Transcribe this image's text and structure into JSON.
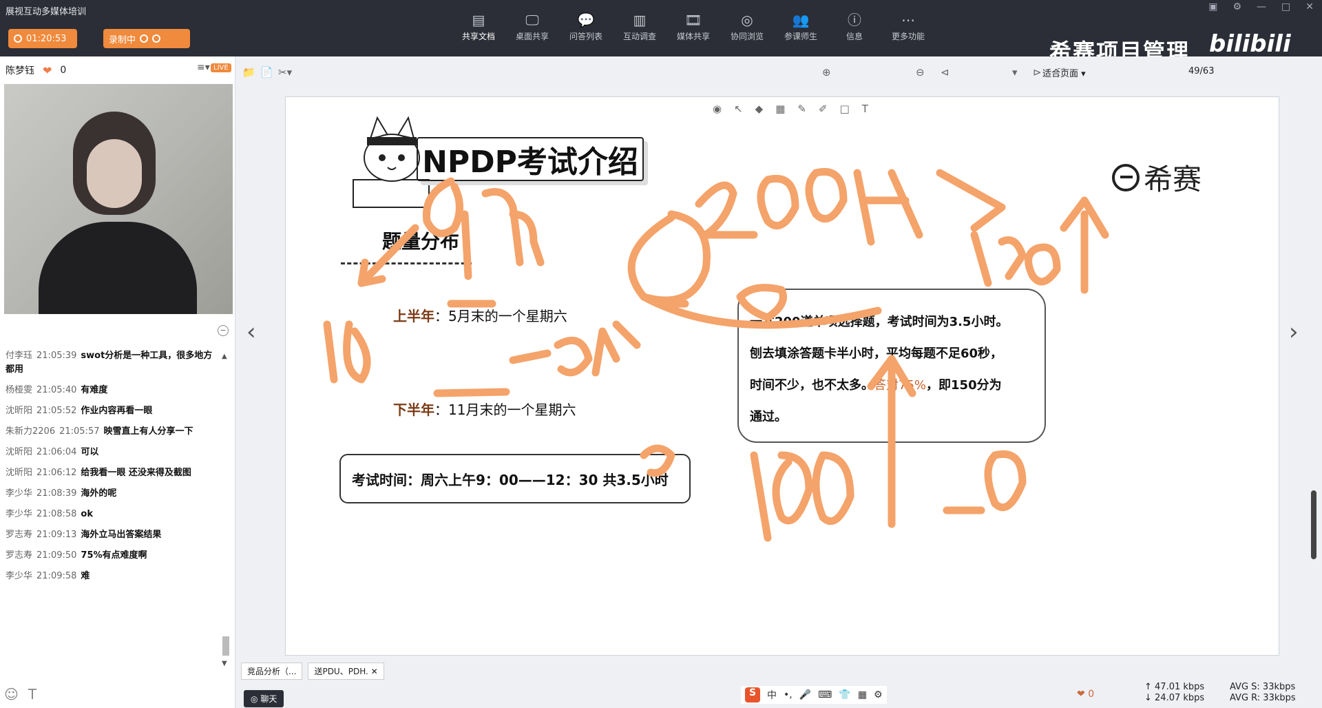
{
  "app": {
    "title": "展视互动多媒体培训",
    "timer": "01:20:53",
    "recording_label": "录制中",
    "brand": "希赛项目管理",
    "bili": "bilibili"
  },
  "toolbar": {
    "items": [
      {
        "label": "共享文档",
        "icon": "document-icon",
        "glyph": "▤"
      },
      {
        "label": "桌面共享",
        "icon": "screen-share-icon",
        "glyph": "🖵"
      },
      {
        "label": "问答列表",
        "icon": "qa-icon",
        "glyph": "💬"
      },
      {
        "label": "互动调查",
        "icon": "survey-icon",
        "glyph": "▥"
      },
      {
        "label": "媒体共享",
        "icon": "media-icon",
        "glyph": "🎞"
      },
      {
        "label": "协同浏览",
        "icon": "browse-icon",
        "glyph": "◎"
      },
      {
        "label": "参课师生",
        "icon": "users-icon",
        "glyph": "👥"
      },
      {
        "label": "信息",
        "icon": "info-icon",
        "glyph": "ⓘ"
      },
      {
        "label": "更多功能",
        "icon": "more-icon",
        "glyph": "⋯"
      }
    ]
  },
  "left": {
    "user_name": "陈梦钰",
    "flower_count": "0",
    "live_badge": "LIVE",
    "chat": [
      {
        "name": "付李珏",
        "time": "21:05:39",
        "msg": "swot分析是一种工具，很多地方都用"
      },
      {
        "name": "杨桠雯",
        "time": "21:05:40",
        "msg": "有难度"
      },
      {
        "name": "沈昕阳",
        "time": "21:05:52",
        "msg": "作业内容再看一眼"
      },
      {
        "name": "朱新力2206",
        "time": "21:05:57",
        "msg": "映雪直上有人分享一下"
      },
      {
        "name": "沈昕阳",
        "time": "21:06:04",
        "msg": "可以"
      },
      {
        "name": "沈昕阳",
        "time": "21:06:12",
        "msg": "给我看一眼 还没来得及截图"
      },
      {
        "name": "李少华",
        "time": "21:08:39",
        "msg": "海外的呢"
      },
      {
        "name": "李少华",
        "time": "21:08:58",
        "msg": "ok"
      },
      {
        "name": "罗志寿",
        "time": "21:09:13",
        "msg": "海外立马出答案结果"
      },
      {
        "name": "罗志寿",
        "time": "21:09:50",
        "msg": "75%有点难度啊"
      },
      {
        "name": "李少华",
        "time": "21:09:58",
        "msg": "难"
      }
    ]
  },
  "doc": {
    "zoom": "适合页面",
    "page": "49/63"
  },
  "slide": {
    "title": "NPDP考试介绍",
    "logo_text": "希赛",
    "section": "题量分布",
    "first_half_label": "上半年",
    "first_half_text": "：5月末的一个星期六",
    "second_half_label": "下半年",
    "second_half_text": "：11月末的一个星期六",
    "exam_time": "考试时间：周六上午9：00——12：30  共3.5小时",
    "info_line1": "一共200道单项选择题，考试时间为3.5小时。",
    "info_line2": "刨去填涂答题卡半小时，平均每题不足60秒，",
    "info_line3_a": "时间不少，也不太多。",
    "info_line3_b": "答对75%",
    "info_line3_c": "，即150分为",
    "info_line4": "通过。"
  },
  "bottom": {
    "tab1": "竞品分析（...",
    "tab2": "送PDU、PDH.",
    "chat_tab": "聊天",
    "gift_count": "0",
    "net_up": "47.01 kbps",
    "net_down": "24.07 kbps",
    "avg_s": "AVG S: 33kbps",
    "avg_r": "AVG R: 33kbps"
  },
  "colors": {
    "topbar": "#2b2e36",
    "accent": "#f08a3c",
    "annotation": "#f4a36a"
  }
}
